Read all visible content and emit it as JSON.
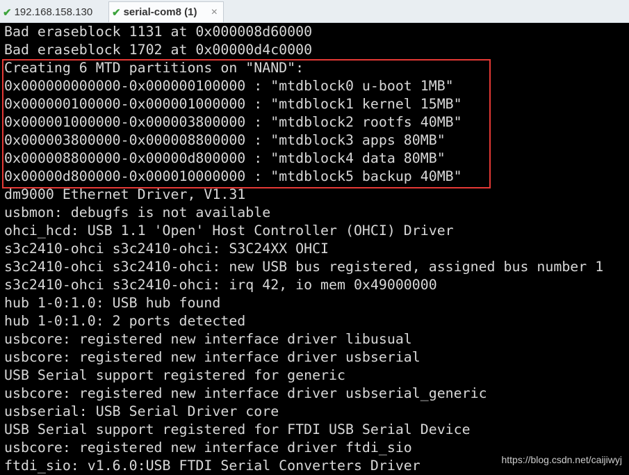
{
  "tabs": [
    {
      "label": "192.168.158.130",
      "icon": "check-icon"
    },
    {
      "label": "serial-com8 (1)",
      "icon": "check-icon",
      "active": true,
      "close": "×"
    }
  ],
  "lines": [
    "Bad eraseblock 1131 at 0x000008d60000",
    "Bad eraseblock 1702 at 0x00000d4c0000",
    "Creating 6 MTD partitions on \"NAND\":",
    "0x000000000000-0x000000100000 : \"mtdblock0 u-boot 1MB\"",
    "0x000000100000-0x000001000000 : \"mtdblock1 kernel 15MB\"",
    "0x000001000000-0x000003800000 : \"mtdblock2 rootfs 40MB\"",
    "0x000003800000-0x000008800000 : \"mtdblock3 apps 80MB\"",
    "0x000008800000-0x00000d800000 : \"mtdblock4 data 80MB\"",
    "0x00000d800000-0x000010000000 : \"mtdblock5 backup 40MB\"",
    "dm9000 Ethernet Driver, V1.31",
    "usbmon: debugfs is not available",
    "ohci_hcd: USB 1.1 'Open' Host Controller (OHCI) Driver",
    "s3c2410-ohci s3c2410-ohci: S3C24XX OHCI",
    "s3c2410-ohci s3c2410-ohci: new USB bus registered, assigned bus number 1",
    "s3c2410-ohci s3c2410-ohci: irq 42, io mem 0x49000000",
    "hub 1-0:1.0: USB hub found",
    "hub 1-0:1.0: 2 ports detected",
    "usbcore: registered new interface driver libusual",
    "usbcore: registered new interface driver usbserial",
    "USB Serial support registered for generic",
    "usbcore: registered new interface driver usbserial_generic",
    "usbserial: USB Serial Driver core",
    "USB Serial support registered for FTDI USB Serial Device",
    "usbcore: registered new interface driver ftdi_sio",
    "ftdi_sio: v1.6.0:USB FTDI Serial Converters Driver"
  ],
  "watermark": "https://blog.csdn.net/caijiwyj",
  "colors": {
    "highlight": "#e53935",
    "check": "#3ca33c"
  }
}
